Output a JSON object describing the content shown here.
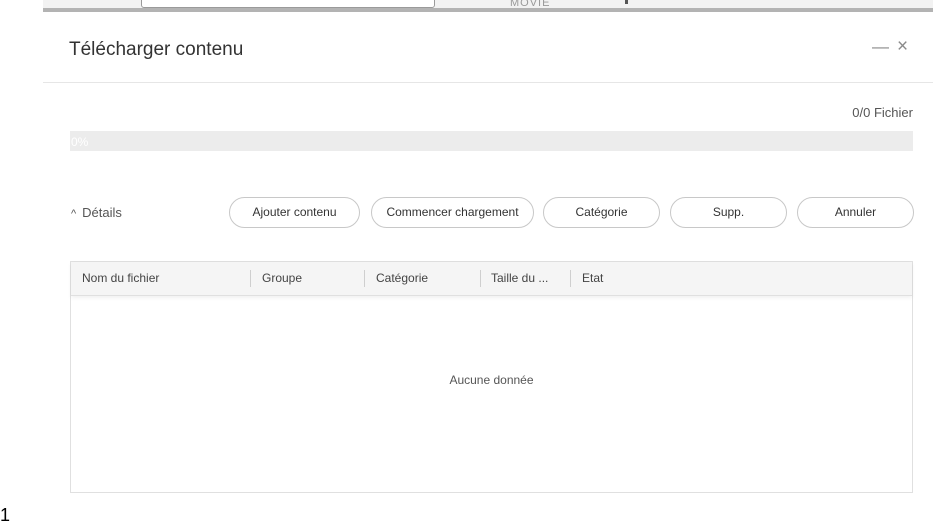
{
  "background_window": {
    "partial_text": "MOVIE"
  },
  "page_number": "1",
  "dialog": {
    "title": "Télécharger contenu",
    "minimize_label": "—",
    "close_label": "×"
  },
  "progress": {
    "file_count": "0/0 Fichier",
    "percent_label": "0%",
    "value": 0
  },
  "details_toggle": {
    "caret": "^",
    "label": "Détails"
  },
  "toolbar": {
    "add_label": "Ajouter contenu",
    "start_label": "Commencer chargement",
    "category_label": "Catégorie",
    "delete_label": "Supp.",
    "cancel_label": "Annuler"
  },
  "table": {
    "columns": [
      "Nom du fichier",
      "Groupe",
      "Catégorie",
      "Taille du ...",
      "Etat"
    ],
    "rows": [],
    "empty_text": "Aucune donnée"
  },
  "colors": {
    "progress_track": "#ececec",
    "border": "#c8c8c8",
    "text": "#333333"
  }
}
